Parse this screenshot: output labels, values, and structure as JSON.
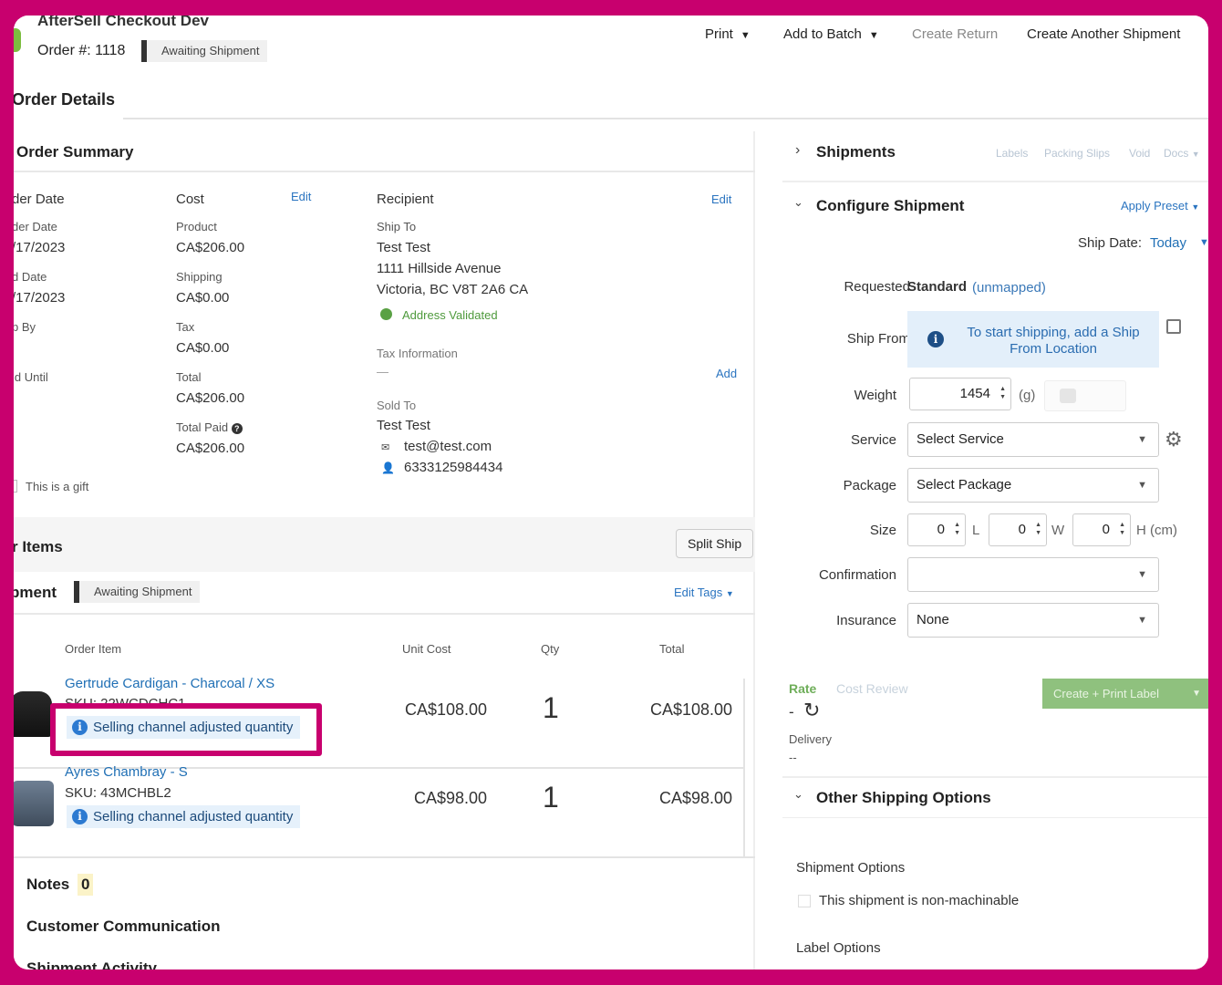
{
  "header": {
    "app_title": "AfterSell Checkout Dev",
    "order_number": "Order #: 1118",
    "status": "Awaiting Shipment",
    "buttons": {
      "print": "Print",
      "add_to_batch": "Add to Batch",
      "create_return": "Create Return",
      "create_another": "Create Another Shipment"
    }
  },
  "tab": {
    "title": "Order Details"
  },
  "order_summary": {
    "title": "Order Summary",
    "dates": {
      "order_date_header": "der Date",
      "order_date_label": "der Date",
      "order_date_value": "/17/2023",
      "paid_date_label": "d Date",
      "paid_date_value": "/17/2023",
      "ship_by_label": "p By",
      "hold_until_label": "ld Until"
    },
    "cost": {
      "header": "Cost",
      "edit": "Edit",
      "product_label": "Product",
      "product_value": "CA$206.00",
      "shipping_label": "Shipping",
      "shipping_value": "CA$0.00",
      "tax_label": "Tax",
      "tax_value": "CA$0.00",
      "total_label": "Total",
      "total_value": "CA$206.00",
      "total_paid_label": "Total Paid",
      "total_paid_value": "CA$206.00"
    },
    "recipient": {
      "header": "Recipient",
      "edit": "Edit",
      "ship_to_label": "Ship To",
      "name": "Test Test",
      "street": "1111 Hillside Avenue",
      "city_line": "Victoria, BC V8T 2A6 CA",
      "validated": "Address Validated",
      "tax_info_label": "Tax Information",
      "tax_info_value": "—",
      "tax_info_add": "Add",
      "sold_to_label": "Sold To",
      "sold_to_name": "Test Test",
      "email": "test@test.com",
      "phone": "6333125984434"
    },
    "gift_label": "This is a gift"
  },
  "items": {
    "title": "r Items",
    "split_ship": "Split Ship",
    "shipment_label": "pment",
    "shipment_status": "Awaiting Shipment",
    "edit_tags": "Edit Tags",
    "columns": [
      "Order Item",
      "Unit Cost",
      "Qty",
      "Total"
    ],
    "rows": [
      {
        "name": "Gertrude Cardigan - Charcoal / XS",
        "sku": "SKU: 22WCDCHC1",
        "notice": "Selling channel adjusted quantity",
        "unit_cost": "CA$108.00",
        "qty": "1",
        "total": "CA$108.00"
      },
      {
        "name": "Ayres Chambray - S",
        "sku": "SKU: 43MCHBL2",
        "notice": "Selling channel adjusted quantity",
        "unit_cost": "CA$98.00",
        "qty": "1",
        "total": "CA$98.00"
      }
    ]
  },
  "sections": {
    "notes": "Notes",
    "notes_count": "0",
    "customer_communication": "Customer Communication",
    "shipment_activity": "Shipment Activity"
  },
  "right": {
    "shipments": {
      "title": "Shipments",
      "labels": "Labels",
      "packing_slips": "Packing Slips",
      "void": "Void",
      "docs": "Docs"
    },
    "configure": {
      "title": "Configure Shipment",
      "apply_preset": "Apply Preset",
      "ship_date_label": "Ship Date:",
      "ship_date_value": "Today",
      "requested_label": "Requested",
      "requested_value": "Standard",
      "requested_mapping": "(unmapped)",
      "ship_from_label": "Ship From",
      "ship_from_message": "To start shipping, add a Ship From Location",
      "weight_label": "Weight",
      "weight_value": "1454",
      "weight_unit": "(g)",
      "service_label": "Service",
      "service_value": "Select Service",
      "package_label": "Package",
      "package_value": "Select Package",
      "size_label": "Size",
      "size_l": "0",
      "size_w": "0",
      "size_h": "0",
      "size_l_unit": "L",
      "size_w_unit": "W",
      "size_h_unit": "H  (cm)",
      "confirmation_label": "Confirmation",
      "confirmation_value": "",
      "insurance_label": "Insurance",
      "insurance_value": "None"
    },
    "rate": {
      "rate_tab": "Rate",
      "cost_review_tab": "Cost Review",
      "rate_value": "-",
      "delivery_label": "Delivery",
      "delivery_value": "--",
      "create_label": "Create + Print Label"
    },
    "other": {
      "title": "Other Shipping Options",
      "shipment_options": "Shipment Options",
      "non_machinable": "This shipment is non-machinable",
      "label_options": "Label Options"
    }
  },
  "colors": {
    "frame": "#c8006e",
    "link": "#1f6fb5",
    "info_bg": "#e6f1fb",
    "create_btn": "#8fc17e"
  }
}
